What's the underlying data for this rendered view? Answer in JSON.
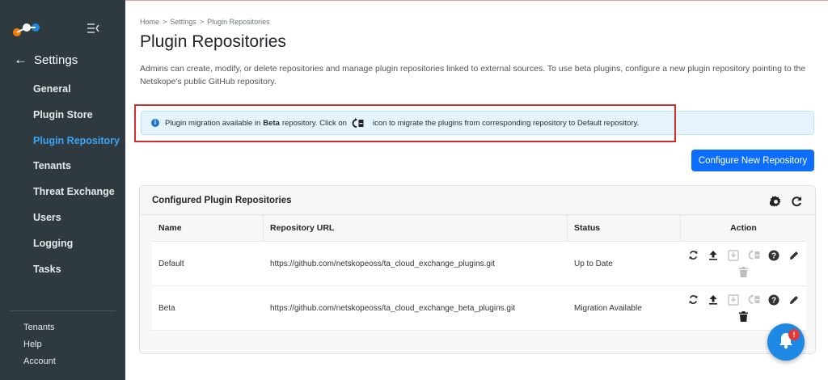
{
  "sidebar": {
    "back_label": "Settings",
    "items": [
      {
        "label": "General"
      },
      {
        "label": "Plugin Store"
      },
      {
        "label": "Plugin Repository"
      },
      {
        "label": "Tenants"
      },
      {
        "label": "Threat Exchange"
      },
      {
        "label": "Users"
      },
      {
        "label": "Logging"
      },
      {
        "label": "Tasks"
      }
    ],
    "active_item": "Plugin Repository",
    "bottom_links": [
      "Tenants",
      "Help",
      "Account"
    ]
  },
  "breadcrumb": [
    "Home",
    "Settings",
    "Plugin Repositories"
  ],
  "breadcrumb_sep": ">",
  "page": {
    "title": "Plugin Repositories",
    "description": "Admins can create, modify, or delete repositories and manage plugin repositories linked to external sources. To use beta plugins, configure a new plugin repository pointing to the Netskope's public GitHub repository."
  },
  "alert": {
    "text_before": "Plugin migration available in",
    "bold": "Beta",
    "text_middle": "repository. Click on",
    "text_after": "icon to migrate the plugins from corresponding repository to Default repository."
  },
  "configure_button": "Configure New Repository",
  "card": {
    "title": "Configured Plugin Repositories",
    "columns": [
      "Name",
      "Repository URL",
      "Status",
      "Action"
    ],
    "rows": [
      {
        "name": "Default",
        "url": "https://github.com/netskopeoss/ta_cloud_exchange_plugins.git",
        "status": "Up to Date",
        "delete_enabled": false
      },
      {
        "name": "Beta",
        "url": "https://github.com/netskopeoss/ta_cloud_exchange_beta_plugins.git",
        "status": "Migration Available",
        "delete_enabled": true
      }
    ]
  },
  "notifications": {
    "badge": "!"
  },
  "colors": {
    "sidebar_bg": "#2f3940",
    "active_nav": "#3aa4f5",
    "primary_button": "#0d6efd",
    "alert_bg": "#e5f3fd",
    "highlight_border": "#d32f2f",
    "fab": "#1e88e5",
    "badge": "#e53935"
  },
  "icons": [
    "logo-icon",
    "menu-collapse-icon",
    "back-arrow-icon",
    "info-icon",
    "migrate-icon",
    "settings-gear-icon",
    "refresh-icon",
    "sync-icon",
    "upload-icon",
    "download-icon",
    "trash-icon",
    "help-icon",
    "edit-pencil-icon",
    "bell-icon"
  ]
}
